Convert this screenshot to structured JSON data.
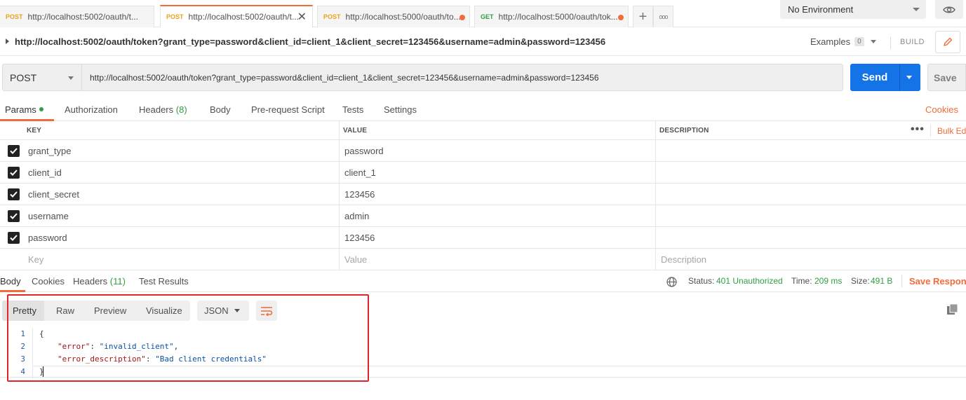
{
  "tabs": [
    {
      "method": "POST",
      "url": "http://localhost:5002/oauth/t...",
      "active": false,
      "unsaved": false
    },
    {
      "method": "POST",
      "url": "http://localhost:5002/oauth/t...",
      "active": true,
      "unsaved": false
    },
    {
      "method": "POST",
      "url": "http://localhost:5000/oauth/to...",
      "active": false,
      "unsaved": true
    },
    {
      "method": "GET",
      "url": "http://localhost:5000/oauth/tok...",
      "active": false,
      "unsaved": true
    }
  ],
  "new_tab_symbol": "+",
  "more_tabs_symbol": "ooo",
  "environment": "No Environment",
  "request_title": "http://localhost:5002/oauth/token?grant_type=password&client_id=client_1&client_secret=123456&username=admin&password=123456",
  "examples": {
    "label": "Examples",
    "count": "0"
  },
  "build_label": "BUILD",
  "method": "POST",
  "url": "http://localhost:5002/oauth/token?grant_type=password&client_id=client_1&client_secret=123456&username=admin&password=123456",
  "send_label": "Send",
  "save_label": "Save",
  "request_tabs": {
    "params": "Params",
    "authorization": "Authorization",
    "headers": "Headers",
    "headers_count": "(8)",
    "body": "Body",
    "prerequest": "Pre-request Script",
    "tests": "Tests",
    "settings": "Settings"
  },
  "cookies_link": "Cookies",
  "params_table": {
    "headers": {
      "key": "KEY",
      "value": "VALUE",
      "description": "DESCRIPTION"
    },
    "bulk_edit": "Bulk Edit",
    "rows": [
      {
        "key": "grant_type",
        "value": "password",
        "description": ""
      },
      {
        "key": "client_id",
        "value": "client_1",
        "description": ""
      },
      {
        "key": "client_secret",
        "value": "123456",
        "description": ""
      },
      {
        "key": "username",
        "value": "admin",
        "description": ""
      },
      {
        "key": "password",
        "value": "123456",
        "description": ""
      }
    ],
    "placeholders": {
      "key": "Key",
      "value": "Value",
      "description": "Description"
    }
  },
  "response_tabs": {
    "body": "Body",
    "cookies": "Cookies",
    "headers": "Headers",
    "headers_count": "(11)",
    "test_results": "Test Results"
  },
  "response_status": {
    "status_label": "Status:",
    "status_value": "401 Unauthorized",
    "time_label": "Time:",
    "time_value": "209 ms",
    "size_label": "Size:",
    "size_value": "491 B",
    "save_response": "Save Response"
  },
  "view_modes": [
    "Pretty",
    "Raw",
    "Preview",
    "Visualize"
  ],
  "format": "JSON",
  "response_body": {
    "line_numbers": [
      "1",
      "2",
      "3",
      "4"
    ],
    "open_brace": "{",
    "close_brace": "}",
    "error_key": "\"error\"",
    "error_value": "\"invalid_client\"",
    "desc_key": "\"error_description\"",
    "desc_value": "\"Bad client credentials\""
  },
  "colors": {
    "accent": "#f26b3a",
    "send": "#1473e6",
    "success": "#2f9e44",
    "highlight_box": "#e0242a"
  }
}
